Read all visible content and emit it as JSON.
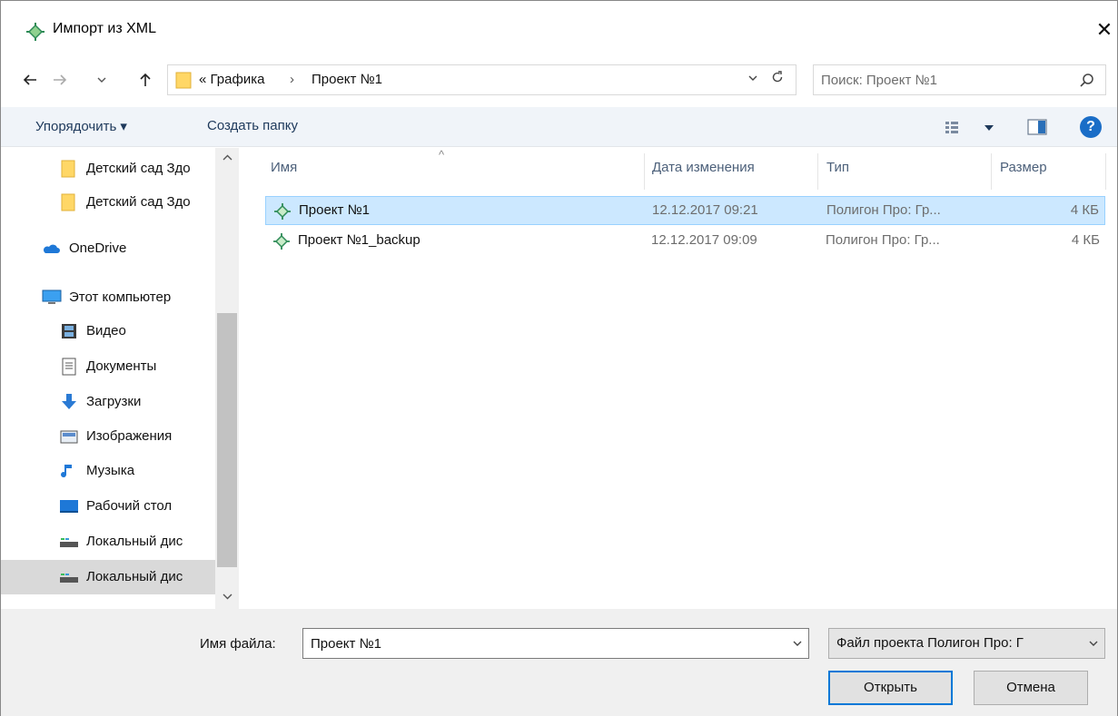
{
  "window": {
    "title": "Импорт из XML",
    "close_symbol": "✕"
  },
  "nav": {
    "back_icon": "arrow-left-icon",
    "forward_icon": "arrow-right-icon",
    "recent_icon": "chevron-down-icon",
    "up_icon": "arrow-up-icon",
    "breadcrumb": [
      "« Графика",
      "Проект №1"
    ],
    "breadcrumb_separator": "›",
    "search_placeholder": "Поиск: Проект №1"
  },
  "toolbar": {
    "organize_label": "Упорядочить ▾",
    "new_folder_label": "Создать папку"
  },
  "navpane": {
    "items": [
      {
        "label": "Детский сад Здо",
        "icon": "folder-icon",
        "indent": 2
      },
      {
        "label": "Детский сад Здо",
        "icon": "folder-icon",
        "indent": 2
      },
      {
        "label": "OneDrive",
        "icon": "cloud-icon",
        "indent": 1
      },
      {
        "label": "Этот компьютер",
        "icon": "computer-icon",
        "indent": 1
      },
      {
        "label": "Видео",
        "icon": "video-icon",
        "indent": 2
      },
      {
        "label": "Документы",
        "icon": "documents-icon",
        "indent": 2
      },
      {
        "label": "Загрузки",
        "icon": "downloads-icon",
        "indent": 2
      },
      {
        "label": "Изображения",
        "icon": "pictures-icon",
        "indent": 2
      },
      {
        "label": "Музыка",
        "icon": "music-icon",
        "indent": 2
      },
      {
        "label": "Рабочий стол",
        "icon": "desktop-icon",
        "indent": 2
      },
      {
        "label": "Локальный дис",
        "icon": "drive-icon",
        "indent": 2
      },
      {
        "label": "Локальный дис",
        "icon": "drive-icon",
        "indent": 2,
        "selected": true
      }
    ]
  },
  "filelist": {
    "columns": [
      "Имя",
      "Дата изменения",
      "Тип",
      "Размер"
    ],
    "rows": [
      {
        "name": "Проект №1",
        "date": "12.12.2017 09:21",
        "type": "Полигон Про: Гр...",
        "size": "4 КБ",
        "selected": true
      },
      {
        "name": "Проект №1_backup",
        "date": "12.12.2017 09:09",
        "type": "Полигон Про: Гр...",
        "size": "4 КБ",
        "selected": false
      }
    ]
  },
  "bottom": {
    "filename_label": "Имя файла:",
    "filename_value": "Проект №1",
    "filetype_value": "Файл проекта Полигон Про: Г",
    "open_label": "Открыть",
    "cancel_label": "Отмена"
  },
  "colors": {
    "selection_bg": "#cce8ff",
    "selection_border": "#99d1ff",
    "toolbar_bg": "#f0f4f9",
    "accent": "#0078d7",
    "project_icon": "#2e8b57"
  }
}
